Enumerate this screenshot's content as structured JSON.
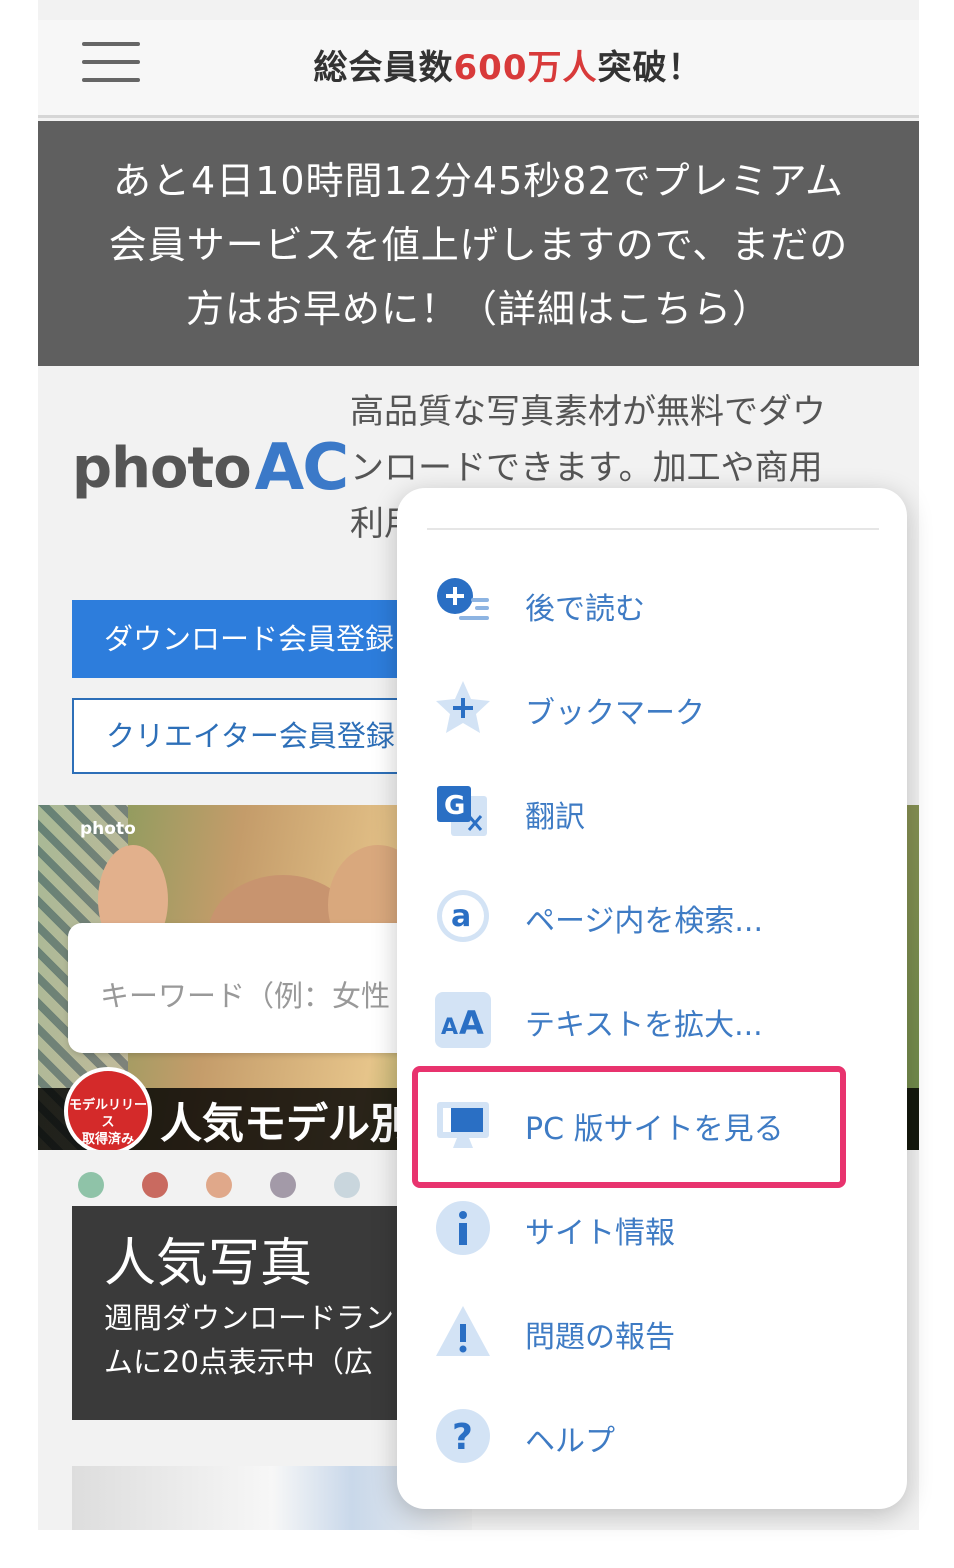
{
  "header": {
    "title_before": "総会員数",
    "title_highlight": "600万人",
    "title_after": "突破！",
    "highlight_color": "#d83a3a"
  },
  "banner": {
    "lines": [
      "あと4日10時間12分45秒82でプレミアム",
      "会員サービスを値上げしますので、まだの",
      "方はお早めに！（詳細はこちら）"
    ]
  },
  "intro": {
    "logo_text": "photo",
    "logo_accent": "AC",
    "lines": [
      "高品質な写真素材が無料でダウ",
      "ンロードできます。加工や商用",
      "利用"
    ]
  },
  "buttons": {
    "download": "ダウンロード会員登録",
    "creator": "クリエイター会員登録"
  },
  "hero": {
    "logo": "photo",
    "search_placeholder": "キーワード（例：女性",
    "badge_line1": "モデルリリース",
    "badge_line2": "取得済み",
    "caption": "人気モデル別"
  },
  "carousel_dots": [
    "#8fc3a8",
    "#c96a60",
    "#e0a88a",
    "#a39aa8",
    "#c9d6dd"
  ],
  "popular": {
    "title": "人気写真",
    "desc_line1": "週間ダウンロードラン",
    "desc_line2": "ムに20点表示中（広"
  },
  "menu": {
    "accent_color": "#3e7bc4",
    "highlight_color": "#e8336e",
    "items": [
      {
        "label": "後で読む",
        "icon": "read-later-icon"
      },
      {
        "label": "ブックマーク",
        "icon": "bookmark-star-icon"
      },
      {
        "label": "翻訳",
        "icon": "translate-icon"
      },
      {
        "label": "ページ内を検索...",
        "icon": "find-in-page-icon"
      },
      {
        "label": "テキストを拡大...",
        "icon": "text-size-icon"
      },
      {
        "label": "PC 版サイトを見る",
        "icon": "desktop-site-icon"
      },
      {
        "label": "サイト情報",
        "icon": "info-icon"
      },
      {
        "label": "問題の報告",
        "icon": "warning-icon"
      },
      {
        "label": "ヘルプ",
        "icon": "help-icon"
      }
    ]
  }
}
